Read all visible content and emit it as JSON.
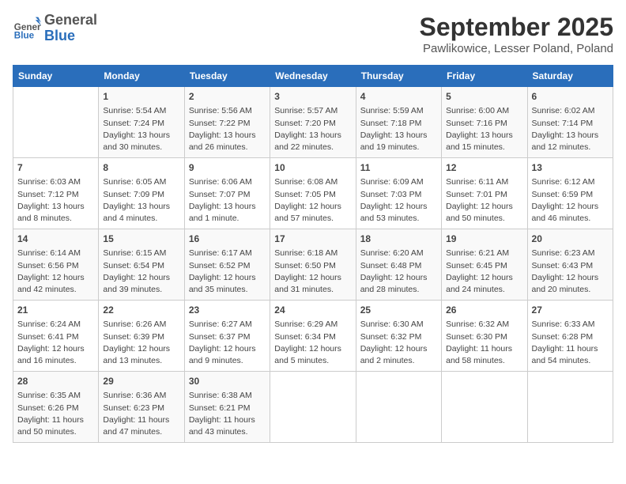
{
  "header": {
    "logo": {
      "general": "General",
      "blue": "Blue"
    },
    "month": "September 2025",
    "location": "Pawlikowice, Lesser Poland, Poland"
  },
  "weekdays": [
    "Sunday",
    "Monday",
    "Tuesday",
    "Wednesday",
    "Thursday",
    "Friday",
    "Saturday"
  ],
  "weeks": [
    [
      {
        "day": "",
        "info": ""
      },
      {
        "day": "1",
        "info": "Sunrise: 5:54 AM\nSunset: 7:24 PM\nDaylight: 13 hours\nand 30 minutes."
      },
      {
        "day": "2",
        "info": "Sunrise: 5:56 AM\nSunset: 7:22 PM\nDaylight: 13 hours\nand 26 minutes."
      },
      {
        "day": "3",
        "info": "Sunrise: 5:57 AM\nSunset: 7:20 PM\nDaylight: 13 hours\nand 22 minutes."
      },
      {
        "day": "4",
        "info": "Sunrise: 5:59 AM\nSunset: 7:18 PM\nDaylight: 13 hours\nand 19 minutes."
      },
      {
        "day": "5",
        "info": "Sunrise: 6:00 AM\nSunset: 7:16 PM\nDaylight: 13 hours\nand 15 minutes."
      },
      {
        "day": "6",
        "info": "Sunrise: 6:02 AM\nSunset: 7:14 PM\nDaylight: 13 hours\nand 12 minutes."
      }
    ],
    [
      {
        "day": "7",
        "info": "Sunrise: 6:03 AM\nSunset: 7:12 PM\nDaylight: 13 hours\nand 8 minutes."
      },
      {
        "day": "8",
        "info": "Sunrise: 6:05 AM\nSunset: 7:09 PM\nDaylight: 13 hours\nand 4 minutes."
      },
      {
        "day": "9",
        "info": "Sunrise: 6:06 AM\nSunset: 7:07 PM\nDaylight: 13 hours\nand 1 minute."
      },
      {
        "day": "10",
        "info": "Sunrise: 6:08 AM\nSunset: 7:05 PM\nDaylight: 12 hours\nand 57 minutes."
      },
      {
        "day": "11",
        "info": "Sunrise: 6:09 AM\nSunset: 7:03 PM\nDaylight: 12 hours\nand 53 minutes."
      },
      {
        "day": "12",
        "info": "Sunrise: 6:11 AM\nSunset: 7:01 PM\nDaylight: 12 hours\nand 50 minutes."
      },
      {
        "day": "13",
        "info": "Sunrise: 6:12 AM\nSunset: 6:59 PM\nDaylight: 12 hours\nand 46 minutes."
      }
    ],
    [
      {
        "day": "14",
        "info": "Sunrise: 6:14 AM\nSunset: 6:56 PM\nDaylight: 12 hours\nand 42 minutes."
      },
      {
        "day": "15",
        "info": "Sunrise: 6:15 AM\nSunset: 6:54 PM\nDaylight: 12 hours\nand 39 minutes."
      },
      {
        "day": "16",
        "info": "Sunrise: 6:17 AM\nSunset: 6:52 PM\nDaylight: 12 hours\nand 35 minutes."
      },
      {
        "day": "17",
        "info": "Sunrise: 6:18 AM\nSunset: 6:50 PM\nDaylight: 12 hours\nand 31 minutes."
      },
      {
        "day": "18",
        "info": "Sunrise: 6:20 AM\nSunset: 6:48 PM\nDaylight: 12 hours\nand 28 minutes."
      },
      {
        "day": "19",
        "info": "Sunrise: 6:21 AM\nSunset: 6:45 PM\nDaylight: 12 hours\nand 24 minutes."
      },
      {
        "day": "20",
        "info": "Sunrise: 6:23 AM\nSunset: 6:43 PM\nDaylight: 12 hours\nand 20 minutes."
      }
    ],
    [
      {
        "day": "21",
        "info": "Sunrise: 6:24 AM\nSunset: 6:41 PM\nDaylight: 12 hours\nand 16 minutes."
      },
      {
        "day": "22",
        "info": "Sunrise: 6:26 AM\nSunset: 6:39 PM\nDaylight: 12 hours\nand 13 minutes."
      },
      {
        "day": "23",
        "info": "Sunrise: 6:27 AM\nSunset: 6:37 PM\nDaylight: 12 hours\nand 9 minutes."
      },
      {
        "day": "24",
        "info": "Sunrise: 6:29 AM\nSunset: 6:34 PM\nDaylight: 12 hours\nand 5 minutes."
      },
      {
        "day": "25",
        "info": "Sunrise: 6:30 AM\nSunset: 6:32 PM\nDaylight: 12 hours\nand 2 minutes."
      },
      {
        "day": "26",
        "info": "Sunrise: 6:32 AM\nSunset: 6:30 PM\nDaylight: 11 hours\nand 58 minutes."
      },
      {
        "day": "27",
        "info": "Sunrise: 6:33 AM\nSunset: 6:28 PM\nDaylight: 11 hours\nand 54 minutes."
      }
    ],
    [
      {
        "day": "28",
        "info": "Sunrise: 6:35 AM\nSunset: 6:26 PM\nDaylight: 11 hours\nand 50 minutes."
      },
      {
        "day": "29",
        "info": "Sunrise: 6:36 AM\nSunset: 6:23 PM\nDaylight: 11 hours\nand 47 minutes."
      },
      {
        "day": "30",
        "info": "Sunrise: 6:38 AM\nSunset: 6:21 PM\nDaylight: 11 hours\nand 43 minutes."
      },
      {
        "day": "",
        "info": ""
      },
      {
        "day": "",
        "info": ""
      },
      {
        "day": "",
        "info": ""
      },
      {
        "day": "",
        "info": ""
      }
    ]
  ]
}
